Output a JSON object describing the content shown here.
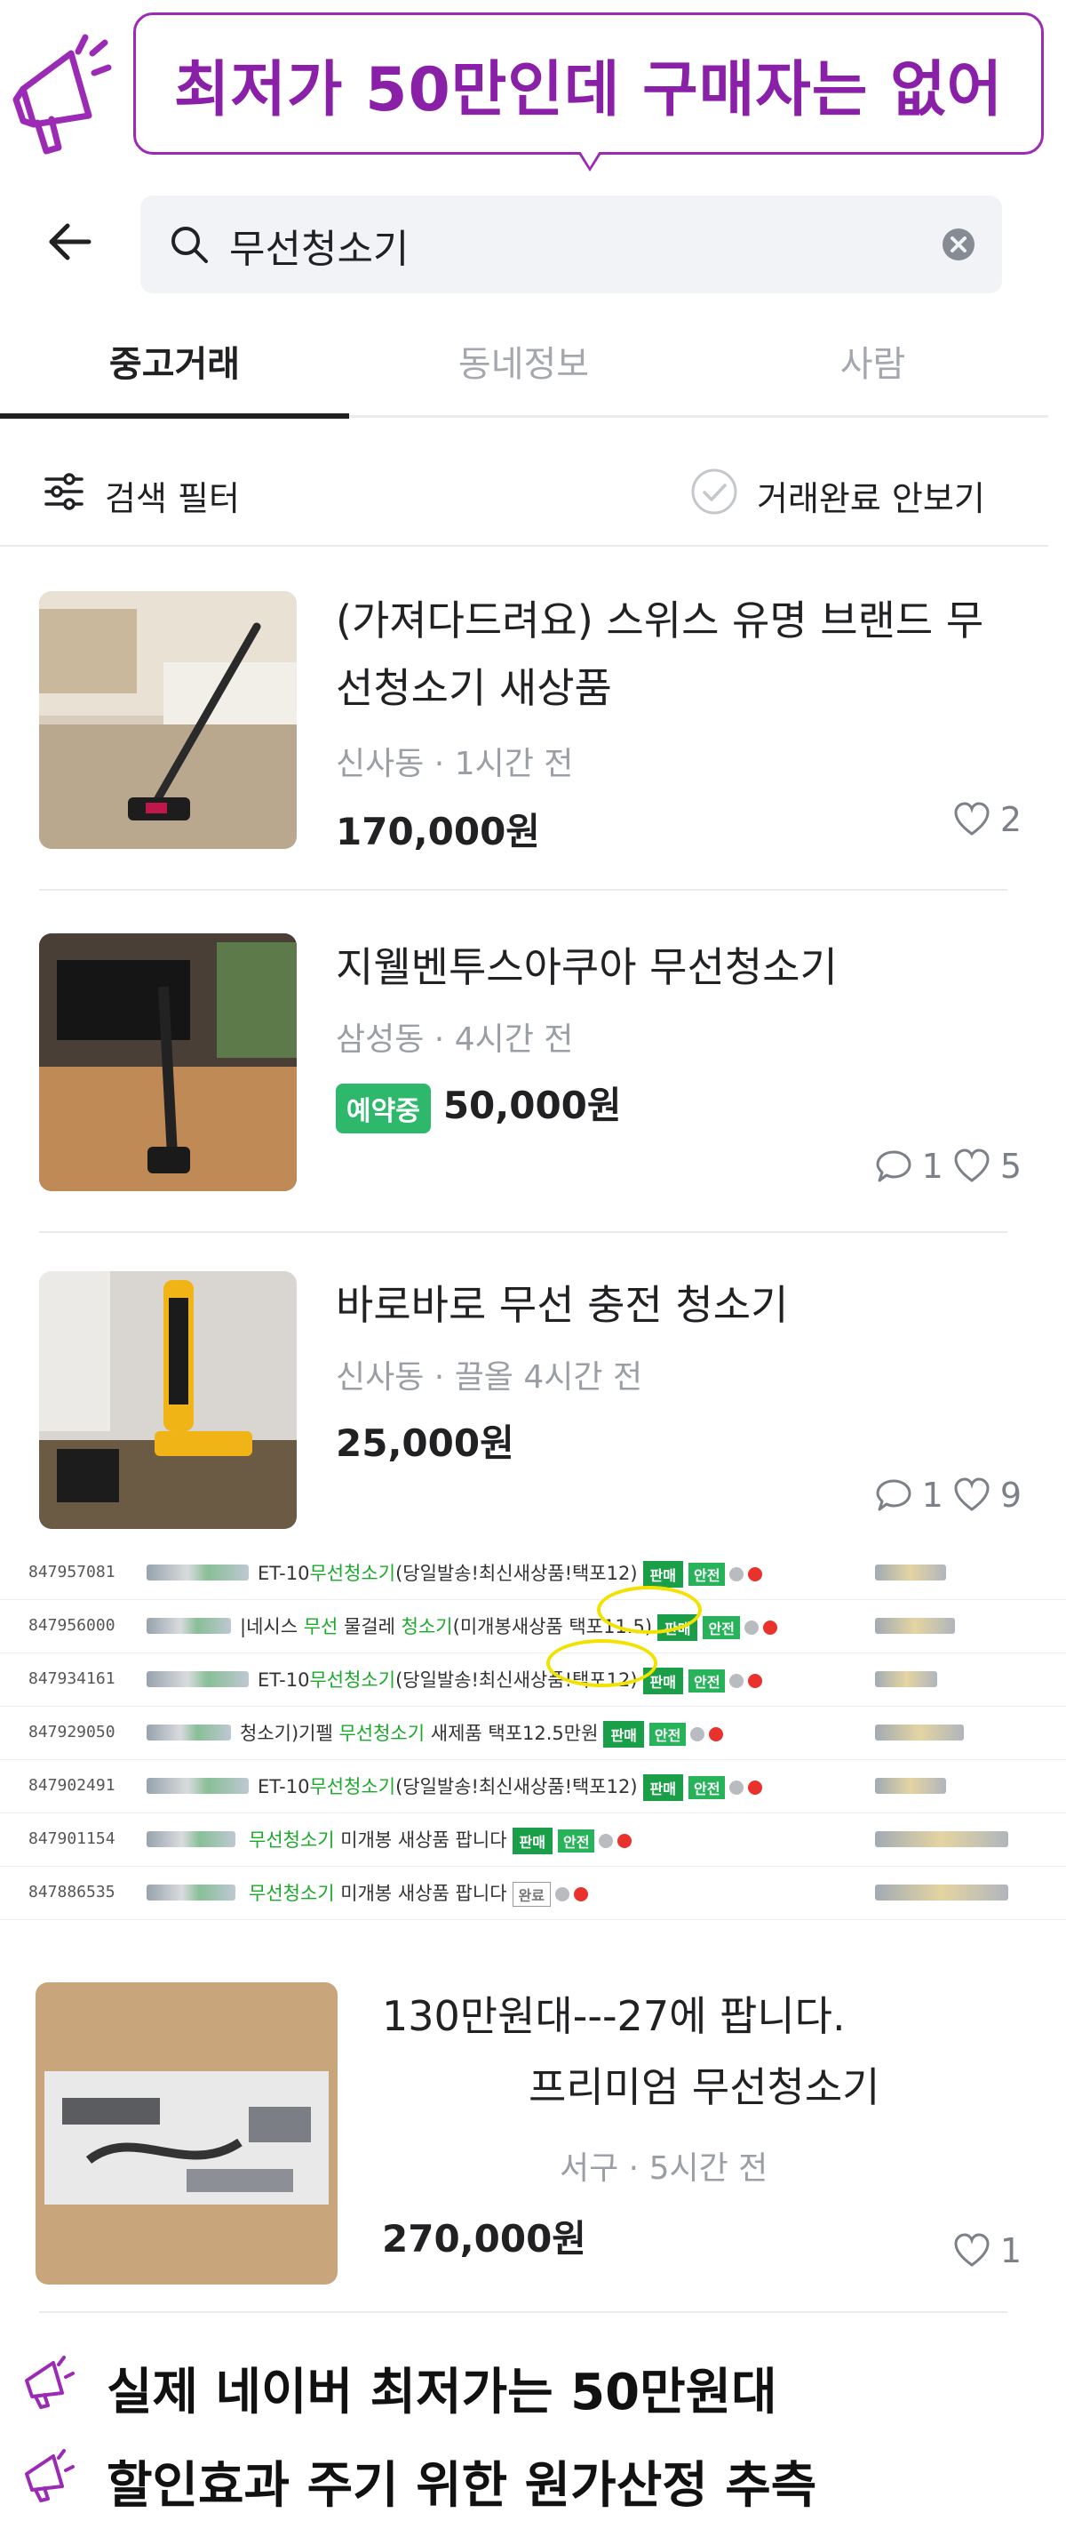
{
  "banner": {
    "text": "최저가 50만인데 구매자는 없어",
    "accent": "#8a1fa8"
  },
  "search": {
    "value": "무선청소기",
    "icons": [
      "back-arrow-icon",
      "search-icon",
      "clear-icon"
    ]
  },
  "tabs": [
    {
      "label": "중고거래",
      "active": true
    },
    {
      "label": "동네정보",
      "active": false
    },
    {
      "label": "사람",
      "active": false
    }
  ],
  "filter": {
    "label": "검색 필터",
    "hide_done_label": "거래완료 안보기"
  },
  "listings": [
    {
      "title": "(가져다드려요) 스위스 유명 브랜드 무선청소기 새상품",
      "meta": "신사동 · 1시간 전",
      "price": "170,000원",
      "badge": "",
      "chats": "",
      "likes": "2"
    },
    {
      "title": "지웰벤투스아쿠아 무선청소기",
      "meta": "삼성동 · 4시간 전",
      "price": "50,000원",
      "badge": "예약중",
      "chats": "1",
      "likes": "5"
    },
    {
      "title": "바로바로 무선 충전 청소기",
      "meta": "신사동 · 끌올 4시간 전",
      "price": "25,000원",
      "badge": "",
      "chats": "1",
      "likes": "9"
    },
    {
      "title_line1": "130만원대---27에 팝니다.",
      "title_line2": "프리미엄 무선청소기",
      "meta": "서구 · 5시간 전",
      "price": "270,000원",
      "badge": "",
      "chats": "",
      "likes": "1"
    }
  ],
  "strip": {
    "rows": [
      {
        "id": "847957081",
        "pre": "ET-10",
        "green": "무선청소기",
        "post": "(당일발송!최신새상품!택포12)",
        "tags": [
          "판매",
          "안전"
        ]
      },
      {
        "id": "847956000",
        "pre": "|네시스 ",
        "green": "무선",
        "mid": " 물걸레 ",
        "green2": "청소기",
        "post": "(미개봉새상품 택포11.5)",
        "tags": [
          "판매",
          "안전"
        ]
      },
      {
        "id": "847934161",
        "pre": "ET-10",
        "green": "무선청소기",
        "post": "(당일발송!최신새상품!택포12)",
        "tags": [
          "판매",
          "안전"
        ]
      },
      {
        "id": "847929050",
        "pre": "청소기)기펠 ",
        "green": "무선청소기",
        "post": " 새제품 택포12.5만원",
        "tags": [
          "판매",
          "안전"
        ]
      },
      {
        "id": "847902491",
        "pre": "ET-10",
        "green": "무선청소기",
        "post": "(당일발송!최신새상품!택포12)",
        "tags": [
          "판매",
          "안전"
        ]
      },
      {
        "id": "847901154",
        "pre": "",
        "green": "무선청소기",
        "post": " 미개봉 새상품 팝니다",
        "tags": [
          "판매",
          "안전"
        ]
      },
      {
        "id": "847886535",
        "pre": "",
        "green": "무선청소기",
        "post": " 미개봉 새상품 팝니다",
        "tags": [
          "완료"
        ]
      }
    ]
  },
  "captions": [
    {
      "text": "실제 네이버 최저가는 50만원대"
    },
    {
      "text": "할인효과 주기 위한 원가산정 추측"
    }
  ]
}
